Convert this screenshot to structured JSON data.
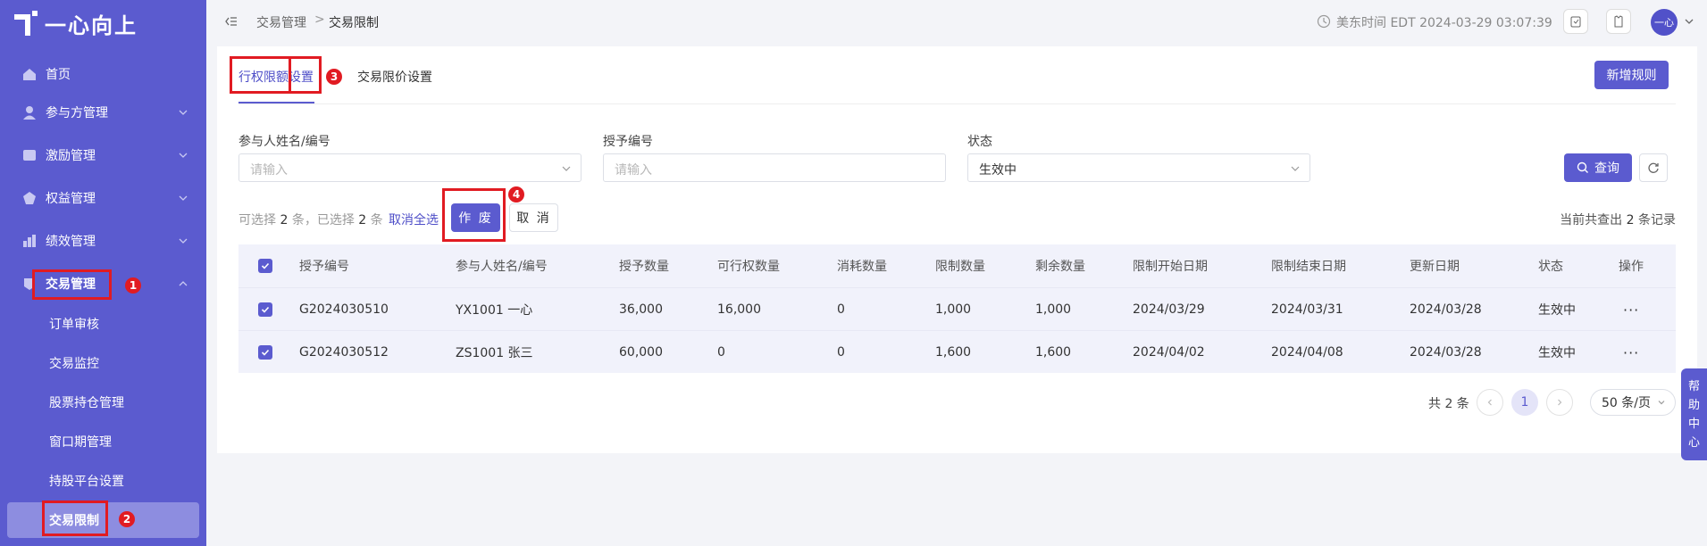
{
  "app": {
    "logo_text": "一心向上"
  },
  "sidebar": {
    "items": [
      {
        "label": "首页",
        "icon": "home-icon"
      },
      {
        "label": "参与方管理",
        "icon": "participants-icon"
      },
      {
        "label": "激励管理",
        "icon": "incentive-icon"
      },
      {
        "label": "权益管理",
        "icon": "equity-icon"
      },
      {
        "label": "绩效管理",
        "icon": "performance-icon"
      },
      {
        "label": "交易管理",
        "icon": "trade-icon"
      }
    ],
    "sub_items": [
      {
        "label": "订单审核"
      },
      {
        "label": "交易监控"
      },
      {
        "label": "股票持仓管理"
      },
      {
        "label": "窗口期管理"
      },
      {
        "label": "持股平台设置"
      },
      {
        "label": "交易限制"
      }
    ]
  },
  "header": {
    "breadcrumb": [
      "交易管理",
      "交易限制"
    ],
    "breadcrumb_sep": ">",
    "time": "美东时间 EDT 2024-03-29 03:07:39",
    "avatar": "一心"
  },
  "annotations": [
    "1",
    "2",
    "3",
    "4"
  ],
  "tabs": [
    {
      "label": "行权限额设置",
      "active": true
    },
    {
      "label": "交易限价设置",
      "active": false
    }
  ],
  "add_rule_label": "新增规则",
  "filters": [
    {
      "label": "参与人姓名/编号",
      "placeholder": "请输入",
      "value": ""
    },
    {
      "label": "授予编号",
      "placeholder": "请输入",
      "value": ""
    },
    {
      "label": "状态",
      "placeholder": "",
      "value": "生效中"
    }
  ],
  "query_label": "查询",
  "selection": {
    "t1": "可选择",
    "selectable": "2",
    "t2": "条，已选择",
    "selected": "2",
    "t3": "条",
    "cancel_all": "取消全选",
    "void_label": "作 废",
    "cancel_label": "取 消"
  },
  "result_count": {
    "prefix": "当前共查出",
    "count": "2",
    "suffix": "条记录"
  },
  "table": {
    "columns": [
      "授予编号",
      "参与人姓名/编号",
      "授予数量",
      "可行权数量",
      "消耗数量",
      "限制数量",
      "剩余数量",
      "限制开始日期",
      "限制结束日期",
      "更新日期",
      "状态",
      "操作"
    ],
    "rows": [
      [
        "G2024030510",
        "YX1001 一心",
        "36,000",
        "16,000",
        "0",
        "1,000",
        "1,000",
        "2024/03/29",
        "2024/03/31",
        "2024/03/28",
        "生效中",
        "···"
      ],
      [
        "G2024030512",
        "ZS1001 张三",
        "60,000",
        "0",
        "0",
        "1,600",
        "1,600",
        "2024/04/02",
        "2024/04/08",
        "2024/03/28",
        "生效中",
        "···"
      ]
    ]
  },
  "pagination": {
    "total": "共 2 条",
    "page": "1",
    "page_size": "50 条/页"
  },
  "help": [
    "帮",
    "助",
    "中",
    "心"
  ],
  "colors": {
    "primary": "#5b5bcf",
    "annotation": "#e11b22"
  }
}
